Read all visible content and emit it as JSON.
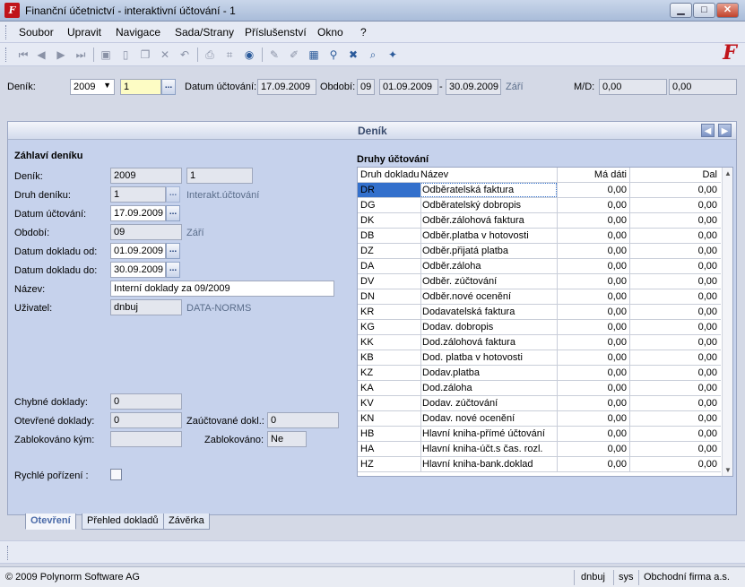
{
  "window": {
    "title": "Finanční účetnictví - interaktivní účtování - 1",
    "app_icon": "F"
  },
  "menu": [
    "Soubor",
    "Upravit",
    "Navigace",
    "Sada/Strany",
    "Příslušenství",
    "Okno",
    "?"
  ],
  "params": {
    "denik_label": "Deník:",
    "year": "2009",
    "journal_no": "1",
    "datum_label": "Datum účtování:",
    "datum": "17.09.2009",
    "obdobi_label": "Období:",
    "obdobi_no": "09",
    "obdobi_from": "01.09.2009",
    "dash": "-",
    "obdobi_to": "30.09.2009",
    "month_name": "Září",
    "md_label": "M/D:",
    "md_1": "0,00",
    "md_2": "0,00",
    "dots": "..."
  },
  "panel": {
    "title": "Deník"
  },
  "header_form": {
    "section_title": "Záhlaví deníku",
    "denik": {
      "label": "Deník:",
      "v1": "2009",
      "v2": "1"
    },
    "druh": {
      "label": "Druh deníku:",
      "value": "1",
      "desc": "Interakt.účtování"
    },
    "datum_uct": {
      "label": "Datum účtování:",
      "value": "17.09.2009"
    },
    "obdobi": {
      "label": "Období:",
      "value": "09",
      "desc": "Září"
    },
    "datum_od": {
      "label": "Datum dokladu od:",
      "value": "01.09.2009"
    },
    "datum_do": {
      "label": "Datum dokladu do:",
      "value": "30.09.2009"
    },
    "nazev": {
      "label": "Název:",
      "value": "Interní doklady za 09/2009"
    },
    "uzivatel": {
      "label": "Uživatel:",
      "value": "dnbuj",
      "desc": "DATA-NORMS"
    },
    "chybne": {
      "label": "Chybné doklady:",
      "value": "0"
    },
    "otevrene": {
      "label": "Otevřené doklady:",
      "value": "0"
    },
    "zauctovane": {
      "label": "Zaúčtované dokl.:",
      "value": "0"
    },
    "blokovano_kym": {
      "label": "Zablokováno kým:",
      "value": ""
    },
    "blokovano": {
      "label": "Zablokováno:",
      "value": "Ne"
    },
    "rychle": {
      "label": "Rychlé pořízení :",
      "checked": false
    }
  },
  "druhy": {
    "section_title": "Druhy účtování",
    "columns": [
      "Druh dokladu",
      "Název",
      "Má dáti",
      "Dal"
    ],
    "rows": [
      [
        "DR",
        "Odběratelská faktura",
        "0,00",
        "0,00"
      ],
      [
        "DG",
        "Odběratelský dobropis",
        "0,00",
        "0,00"
      ],
      [
        "DK",
        "Odběr.zálohová faktura",
        "0,00",
        "0,00"
      ],
      [
        "DB",
        "Odběr.platba v hotovosti",
        "0,00",
        "0,00"
      ],
      [
        "DZ",
        "Odběr.přijatá platba",
        "0,00",
        "0,00"
      ],
      [
        "DA",
        "Odběr.záloha",
        "0,00",
        "0,00"
      ],
      [
        "DV",
        "Odběr. zúčtování",
        "0,00",
        "0,00"
      ],
      [
        "DN",
        "Odběr.nové ocenění",
        "0,00",
        "0,00"
      ],
      [
        "KR",
        "Dodavatelská faktura",
        "0,00",
        "0,00"
      ],
      [
        "KG",
        "Dodav. dobropis",
        "0,00",
        "0,00"
      ],
      [
        "KK",
        "Dod.zálohová faktura",
        "0,00",
        "0,00"
      ],
      [
        "KB",
        "Dod. platba v hotovosti",
        "0,00",
        "0,00"
      ],
      [
        "KZ",
        "Dodav.platba",
        "0,00",
        "0,00"
      ],
      [
        "KA",
        "Dod.záloha",
        "0,00",
        "0,00"
      ],
      [
        "KV",
        "Dodav. zúčtování",
        "0,00",
        "0,00"
      ],
      [
        "KN",
        "Dodav. nové ocenění",
        "0,00",
        "0,00"
      ],
      [
        "HB",
        "Hlavní kniha-přímé účtování",
        "0,00",
        "0,00"
      ],
      [
        "HA",
        "Hlavní kniha-účt.s čas. rozl.",
        "0,00",
        "0,00"
      ],
      [
        "HZ",
        "Hlavní kniha-bank.doklad",
        "0,00",
        "0,00"
      ]
    ],
    "selected_row": 0
  },
  "tabs": [
    "Otevření",
    "Přehled dokladů",
    "Závěrka"
  ],
  "status": {
    "copyright": "© 2009 Polynorm Software AG",
    "user": "dnbuj",
    "system": "sys",
    "firm": "Obchodní firma a.s."
  },
  "colors": {
    "selection": "#3370cc",
    "brand": "#c0141a"
  }
}
